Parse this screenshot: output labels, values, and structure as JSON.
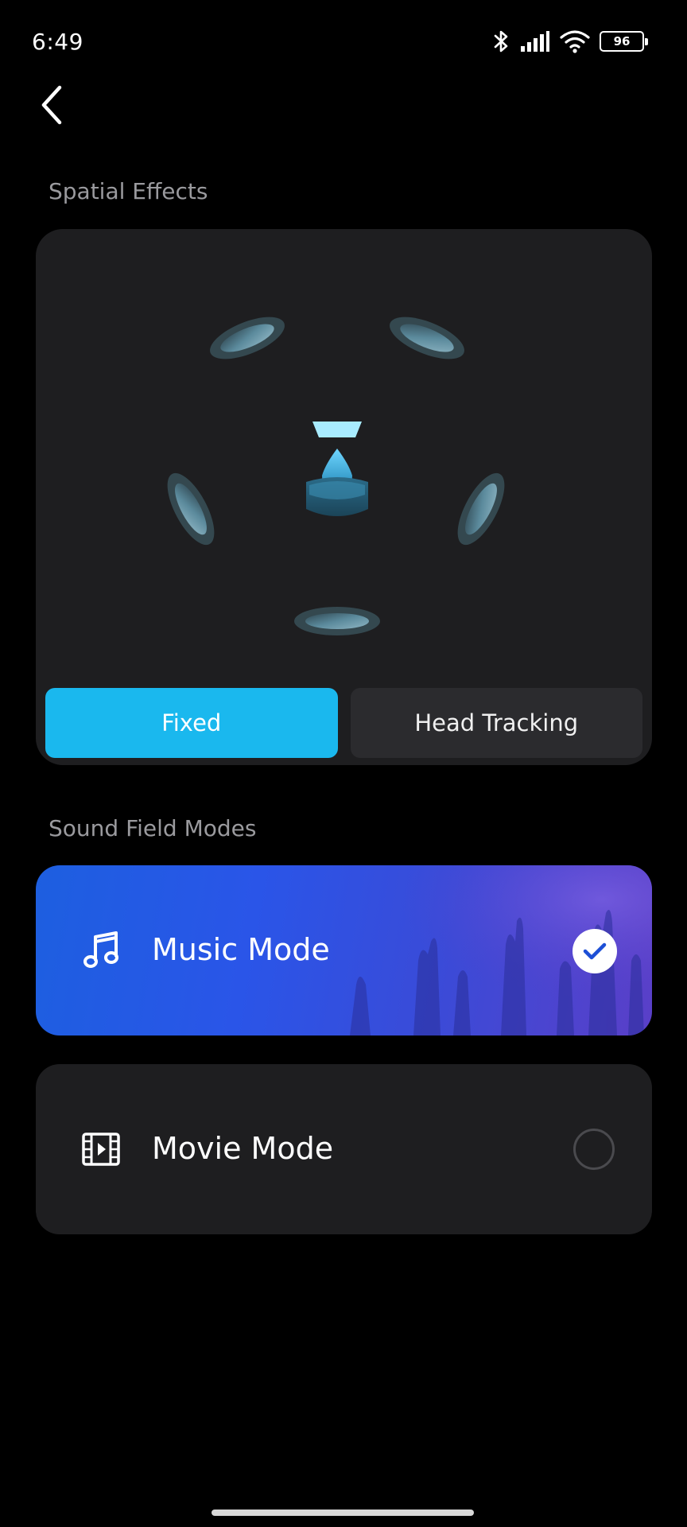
{
  "status_bar": {
    "time": "6:49",
    "battery_level": "96",
    "icons": [
      "bluetooth-icon",
      "signal-icon",
      "wifi-icon",
      "battery-icon"
    ]
  },
  "header": {
    "back_icon": "chevron-left-icon"
  },
  "spatial_effects": {
    "title": "Spatial Effects",
    "options": [
      {
        "label": "Fixed",
        "selected": true
      },
      {
        "label": "Head Tracking",
        "selected": false
      }
    ]
  },
  "sound_field": {
    "title": "Sound Field Modes",
    "modes": [
      {
        "label": "Music Mode",
        "icon": "music-note-icon",
        "selected": true
      },
      {
        "label": "Movie Mode",
        "icon": "film-icon",
        "selected": false
      }
    ]
  },
  "colors": {
    "accent": "#1ab8ee",
    "card_bg": "#1e1e20",
    "selected_gradient_start": "#1d5fe0",
    "selected_gradient_end": "#5a3fc8"
  }
}
